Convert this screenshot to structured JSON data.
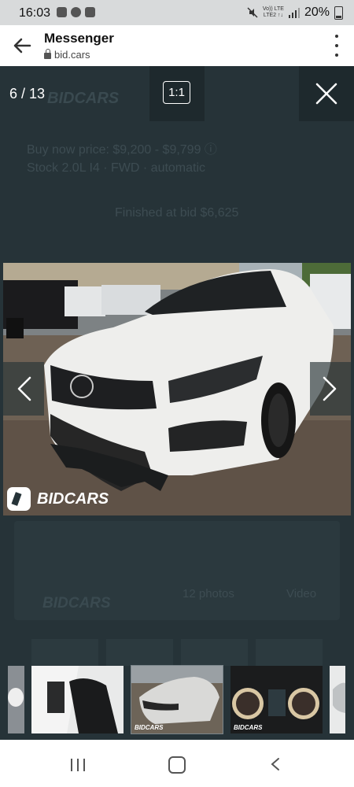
{
  "status_bar": {
    "time": "16:03",
    "net_top": "Vo))  LTE",
    "net_bottom": "LTE2  ↑↓",
    "battery": "20%"
  },
  "app_bar": {
    "title": "Messenger",
    "url": "bid.cars"
  },
  "viewer": {
    "counter": "6 / 13",
    "ratio_label": "1:1",
    "watermark": "BIDCARS"
  },
  "background_page": {
    "logo": "BIDCARS",
    "line1": "Buy now price: $9,200 - $9,799 ⓘ",
    "line2": "Stock 2.0L I4 · FWD · automatic",
    "line3": "Finished at bid $6,625",
    "photos": "12 photos",
    "video": "Video"
  },
  "thumbnails": [
    {
      "name": "thumbnail-partial-left"
    },
    {
      "name": "thumbnail-interior"
    },
    {
      "name": "thumbnail-front",
      "watermark": "BIDCARS"
    },
    {
      "name": "thumbnail-dashboard",
      "watermark": "BIDCARS"
    },
    {
      "name": "thumbnail-partial-right"
    }
  ],
  "colors": {
    "overlay": "#1f2b30",
    "status_bar": "#d8dadb",
    "app_bar": "#ffffff"
  }
}
